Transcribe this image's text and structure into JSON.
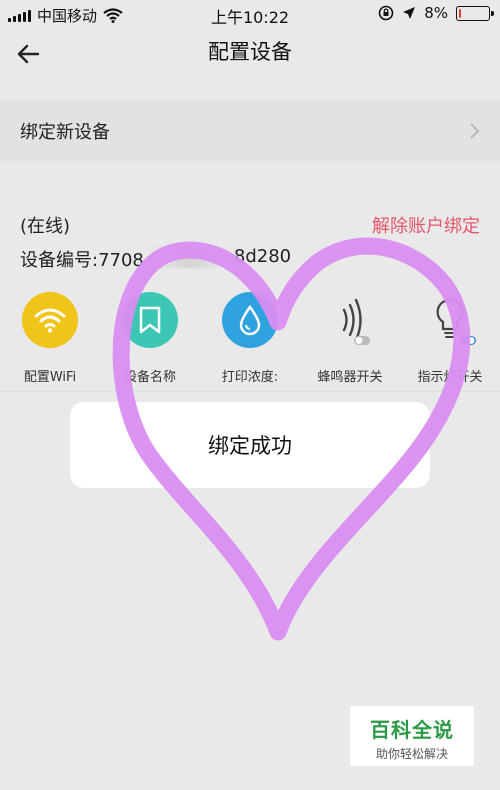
{
  "status_bar": {
    "carrier": "中国移动",
    "time": "上午10:22",
    "battery_text": "8%",
    "battery_level": 0.08
  },
  "nav": {
    "title": "配置设备"
  },
  "bind_new": {
    "label": "绑定新设备"
  },
  "device": {
    "status": "(在线)",
    "unbind_label": "解除账户绑定",
    "id_prefix": "设备编号:7708",
    "id_suffix": "8d280"
  },
  "actions": [
    {
      "label": "配置WiFi",
      "icon": "wifi-icon",
      "color": "#f0c419"
    },
    {
      "label": "设备名称",
      "icon": "bookmark-icon",
      "color": "#3cc7b5"
    },
    {
      "label": "打印浓度:",
      "icon": "drop-icon",
      "color": "#2ea3e0"
    },
    {
      "label": "蜂鸣器开关",
      "icon": "sound-icon",
      "color": "#444444"
    },
    {
      "label": "指示灯开关",
      "icon": "bulb-icon",
      "color": "#444444"
    }
  ],
  "toast": {
    "message": "绑定成功"
  },
  "watermark": {
    "title": "百科全说",
    "subtitle": "助你轻松解决"
  }
}
